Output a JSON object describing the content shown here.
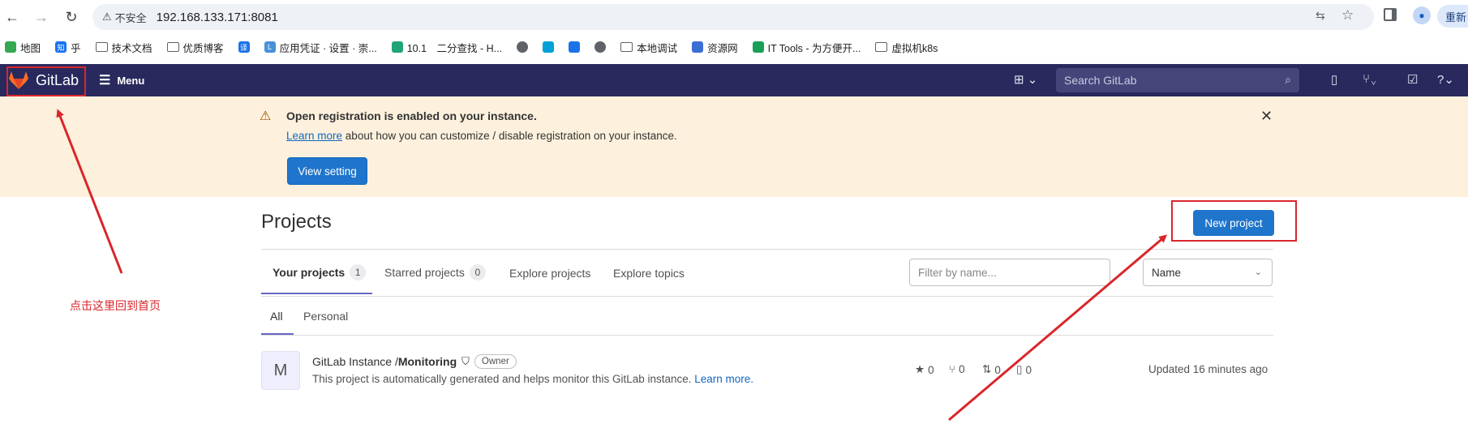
{
  "browser": {
    "url": "192.168.133.171:8081",
    "insecure_label": "不安全",
    "profile_label": "重新"
  },
  "bookmarks": [
    {
      "label": "地图",
      "icon": "maps-icon",
      "color": "#34a853"
    },
    {
      "label": "乎",
      "icon": "zhihu-icon",
      "color": "#1772f6",
      "glyph": "知"
    },
    {
      "label": "技术文档",
      "icon": "folder-icon"
    },
    {
      "label": "优质博客",
      "icon": "folder-icon"
    },
    {
      "label": "",
      "icon": "translate-icon",
      "color": "#1a73e8",
      "glyph": "译"
    },
    {
      "label": "应用凭证 · 设置 · 崇...",
      "icon": "app-icon",
      "color": "#4a90d9",
      "glyph": "L"
    },
    {
      "label": "10.1　二分查找 - H...",
      "icon": "leetcode-icon",
      "color": "#21a37a"
    },
    {
      "label": "",
      "icon": "globe-icon"
    },
    {
      "label": "",
      "icon": "bilibili-icon",
      "color": "#00a1d6"
    },
    {
      "label": "",
      "icon": "doc-icon",
      "color": "#1a73e8"
    },
    {
      "label": "",
      "icon": "globe-icon"
    },
    {
      "label": "本地调试",
      "icon": "folder-icon"
    },
    {
      "label": "资源网",
      "icon": "monitor-icon",
      "color": "#3b6fd4"
    },
    {
      "label": "IT Tools - 为方便开...",
      "icon": "tools-icon",
      "color": "#18a058"
    },
    {
      "label": "虚拟机k8s",
      "icon": "folder-icon"
    }
  ],
  "header": {
    "brand": "GitLab",
    "menu_label": "Menu",
    "search_placeholder": "Search GitLab",
    "accent": "#29295e"
  },
  "banner": {
    "title": "Open registration is enabled on your instance.",
    "link_text": "Learn more",
    "body_text": " about how you can customize / disable registration on your instance.",
    "button_label": "View setting"
  },
  "page": {
    "title": "Projects",
    "new_project_label": "New project",
    "tabs": [
      {
        "label": "Your projects",
        "count": "1"
      },
      {
        "label": "Starred projects",
        "count": "0"
      },
      {
        "label": "Explore projects"
      },
      {
        "label": "Explore topics"
      }
    ],
    "filter_placeholder": "Filter by name...",
    "sort_value": "Name",
    "subtabs": [
      "All",
      "Personal"
    ]
  },
  "project": {
    "avatar_letter": "M",
    "namespace": "GitLab Instance / ",
    "name": "Monitoring",
    "role": "Owner",
    "description": "This project is automatically generated and helps monitor this GitLab instance.",
    "description_link": "Learn more.",
    "stars": "0",
    "forks": "0",
    "merge_requests": "0",
    "issues": "0",
    "updated": "Updated 16 minutes ago"
  },
  "annotation": {
    "text": "点击这里回到首页",
    "color": "#d9262b"
  }
}
